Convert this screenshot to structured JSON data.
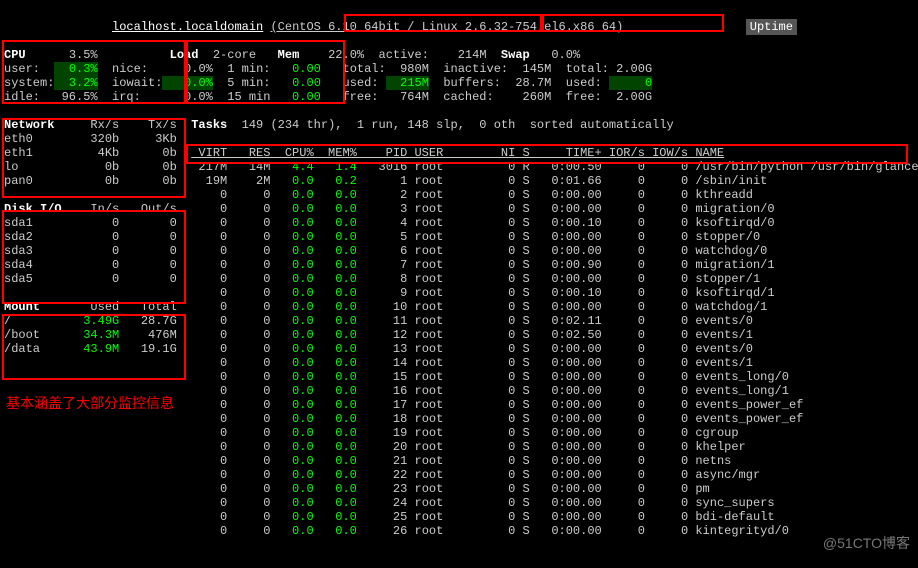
{
  "header": {
    "host": "localhost.localdomain",
    "os": "(CentOS 6.10 64bit / Linux 2.6.32-754.el6.x86_64)",
    "uptime_label": "Uptime"
  },
  "cpu": {
    "label": "CPU",
    "total": "3.5%",
    "user_label": "user:",
    "user": "0.3%",
    "nice_label": "nice:",
    "system_label": "system:",
    "system": "3.2%",
    "iowait_label": "iowait:",
    "idle_label": "idle:",
    "idle": "96.5%",
    "irq_label": "irq:"
  },
  "load": {
    "label": "Load",
    "core": "2-core",
    "c1": "0.0%",
    "m1l": "1 min:",
    "m1": "0.00",
    "c5": "0.0%",
    "m5l": "5 min:",
    "m5": "0.00",
    "c15": "0.0%",
    "m15l": "15 min",
    "m15": "0.00"
  },
  "mem": {
    "label": "Mem",
    "pct": "22.0%",
    "total_l": "total:",
    "total": "980M",
    "used_l": "used:",
    "used": "215M",
    "free_l": "free:",
    "free": "764M",
    "active_l": "active:",
    "active": "214M",
    "inactive_l": "inactive:",
    "inactive": "145M",
    "buffers_l": "buffers:",
    "buffers": "28.7M",
    "cached_l": "cached:",
    "cached": "260M"
  },
  "swap": {
    "label": "Swap",
    "pct": "0.0%",
    "total_l": "total:",
    "total": "2.00G",
    "used_l": "used:",
    "used": "0",
    "free_l": "free:",
    "free": "2.00G"
  },
  "network": {
    "label": "Network",
    "rx": "Rx/s",
    "tx": "Tx/s",
    "rows": [
      {
        "if": "eth0",
        "rx": "320b",
        "tx": "3Kb"
      },
      {
        "if": "eth1",
        "rx": "4Kb",
        "tx": "0b"
      },
      {
        "if": "lo",
        "rx": "0b",
        "tx": "0b"
      },
      {
        "if": "pan0",
        "rx": "0b",
        "tx": "0b"
      }
    ]
  },
  "disk": {
    "label": "Disk I/O",
    "in": "In/s",
    "out": "Out/s",
    "rows": [
      {
        "d": "sda1",
        "i": "0",
        "o": "0"
      },
      {
        "d": "sda2",
        "i": "0",
        "o": "0"
      },
      {
        "d": "sda3",
        "i": "0",
        "o": "0"
      },
      {
        "d": "sda4",
        "i": "0",
        "o": "0"
      },
      {
        "d": "sda5",
        "i": "0",
        "o": "0"
      }
    ]
  },
  "mount": {
    "label": "Mount",
    "used": "Used",
    "total": "Total",
    "rows": [
      {
        "m": "/",
        "u": "3.49G",
        "t": "28.7G"
      },
      {
        "m": "/boot",
        "u": "34.3M",
        "t": "476M"
      },
      {
        "m": "/data",
        "u": "43.9M",
        "t": "19.1G"
      }
    ]
  },
  "tasks": {
    "label": "Tasks",
    "summary": "149 (234 thr),  1 run, 148 slp,  0 oth  sorted automatically"
  },
  "proc_headers": {
    "virt": "VIRT",
    "res": "RES",
    "cpu": "CPU%",
    "mem": "MEM%",
    "pid": "PID",
    "user": "USER",
    "ni": "NI",
    "s": "S",
    "time": "TIME+",
    "ior": "IOR/s",
    "iow": "IOW/s",
    "name": "NAME"
  },
  "procs": [
    {
      "virt": "217M",
      "res": "14M",
      "cpu": "4.4",
      "mem": "1.4",
      "pid": "3016",
      "user": "root",
      "ni": "0",
      "s": "R",
      "time": "0:00.50",
      "ior": "0",
      "iow": "0",
      "name": "/usr/bin/python /usr/bin/glances"
    },
    {
      "virt": "19M",
      "res": "2M",
      "cpu": "0.0",
      "mem": "0.2",
      "pid": "1",
      "user": "root",
      "ni": "0",
      "s": "S",
      "time": "0:01.66",
      "ior": "0",
      "iow": "0",
      "name": "/sbin/init"
    },
    {
      "virt": "0",
      "res": "0",
      "cpu": "0.0",
      "mem": "0.0",
      "pid": "2",
      "user": "root",
      "ni": "0",
      "s": "S",
      "time": "0:00.00",
      "ior": "0",
      "iow": "0",
      "name": "kthreadd"
    },
    {
      "virt": "0",
      "res": "0",
      "cpu": "0.0",
      "mem": "0.0",
      "pid": "3",
      "user": "root",
      "ni": "0",
      "s": "S",
      "time": "0:00.00",
      "ior": "0",
      "iow": "0",
      "name": "migration/0"
    },
    {
      "virt": "0",
      "res": "0",
      "cpu": "0.0",
      "mem": "0.0",
      "pid": "4",
      "user": "root",
      "ni": "0",
      "s": "S",
      "time": "0:00.10",
      "ior": "0",
      "iow": "0",
      "name": "ksoftirqd/0"
    },
    {
      "virt": "0",
      "res": "0",
      "cpu": "0.0",
      "mem": "0.0",
      "pid": "5",
      "user": "root",
      "ni": "0",
      "s": "S",
      "time": "0:00.00",
      "ior": "0",
      "iow": "0",
      "name": "stopper/0"
    },
    {
      "virt": "0",
      "res": "0",
      "cpu": "0.0",
      "mem": "0.0",
      "pid": "6",
      "user": "root",
      "ni": "0",
      "s": "S",
      "time": "0:00.00",
      "ior": "0",
      "iow": "0",
      "name": "watchdog/0"
    },
    {
      "virt": "0",
      "res": "0",
      "cpu": "0.0",
      "mem": "0.0",
      "pid": "7",
      "user": "root",
      "ni": "0",
      "s": "S",
      "time": "0:00.90",
      "ior": "0",
      "iow": "0",
      "name": "migration/1"
    },
    {
      "virt": "0",
      "res": "0",
      "cpu": "0.0",
      "mem": "0.0",
      "pid": "8",
      "user": "root",
      "ni": "0",
      "s": "S",
      "time": "0:00.00",
      "ior": "0",
      "iow": "0",
      "name": "stopper/1"
    },
    {
      "virt": "0",
      "res": "0",
      "cpu": "0.0",
      "mem": "0.0",
      "pid": "9",
      "user": "root",
      "ni": "0",
      "s": "S",
      "time": "0:00.10",
      "ior": "0",
      "iow": "0",
      "name": "ksoftirqd/1"
    },
    {
      "virt": "0",
      "res": "0",
      "cpu": "0.0",
      "mem": "0.0",
      "pid": "10",
      "user": "root",
      "ni": "0",
      "s": "S",
      "time": "0:00.00",
      "ior": "0",
      "iow": "0",
      "name": "watchdog/1"
    },
    {
      "virt": "0",
      "res": "0",
      "cpu": "0.0",
      "mem": "0.0",
      "pid": "11",
      "user": "root",
      "ni": "0",
      "s": "S",
      "time": "0:02.11",
      "ior": "0",
      "iow": "0",
      "name": "events/0"
    },
    {
      "virt": "0",
      "res": "0",
      "cpu": "0.0",
      "mem": "0.0",
      "pid": "12",
      "user": "root",
      "ni": "0",
      "s": "S",
      "time": "0:02.50",
      "ior": "0",
      "iow": "0",
      "name": "events/1"
    },
    {
      "virt": "0",
      "res": "0",
      "cpu": "0.0",
      "mem": "0.0",
      "pid": "13",
      "user": "root",
      "ni": "0",
      "s": "S",
      "time": "0:00.00",
      "ior": "0",
      "iow": "0",
      "name": "events/0"
    },
    {
      "virt": "0",
      "res": "0",
      "cpu": "0.0",
      "mem": "0.0",
      "pid": "14",
      "user": "root",
      "ni": "0",
      "s": "S",
      "time": "0:00.00",
      "ior": "0",
      "iow": "0",
      "name": "events/1"
    },
    {
      "virt": "0",
      "res": "0",
      "cpu": "0.0",
      "mem": "0.0",
      "pid": "15",
      "user": "root",
      "ni": "0",
      "s": "S",
      "time": "0:00.00",
      "ior": "0",
      "iow": "0",
      "name": "events_long/0"
    },
    {
      "virt": "0",
      "res": "0",
      "cpu": "0.0",
      "mem": "0.0",
      "pid": "16",
      "user": "root",
      "ni": "0",
      "s": "S",
      "time": "0:00.00",
      "ior": "0",
      "iow": "0",
      "name": "events_long/1"
    },
    {
      "virt": "0",
      "res": "0",
      "cpu": "0.0",
      "mem": "0.0",
      "pid": "17",
      "user": "root",
      "ni": "0",
      "s": "S",
      "time": "0:00.00",
      "ior": "0",
      "iow": "0",
      "name": "events_power_ef"
    },
    {
      "virt": "0",
      "res": "0",
      "cpu": "0.0",
      "mem": "0.0",
      "pid": "18",
      "user": "root",
      "ni": "0",
      "s": "S",
      "time": "0:00.00",
      "ior": "0",
      "iow": "0",
      "name": "events_power_ef"
    },
    {
      "virt": "0",
      "res": "0",
      "cpu": "0.0",
      "mem": "0.0",
      "pid": "19",
      "user": "root",
      "ni": "0",
      "s": "S",
      "time": "0:00.00",
      "ior": "0",
      "iow": "0",
      "name": "cgroup"
    },
    {
      "virt": "0",
      "res": "0",
      "cpu": "0.0",
      "mem": "0.0",
      "pid": "20",
      "user": "root",
      "ni": "0",
      "s": "S",
      "time": "0:00.00",
      "ior": "0",
      "iow": "0",
      "name": "khelper"
    },
    {
      "virt": "0",
      "res": "0",
      "cpu": "0.0",
      "mem": "0.0",
      "pid": "21",
      "user": "root",
      "ni": "0",
      "s": "S",
      "time": "0:00.00",
      "ior": "0",
      "iow": "0",
      "name": "netns"
    },
    {
      "virt": "0",
      "res": "0",
      "cpu": "0.0",
      "mem": "0.0",
      "pid": "22",
      "user": "root",
      "ni": "0",
      "s": "S",
      "time": "0:00.00",
      "ior": "0",
      "iow": "0",
      "name": "async/mgr"
    },
    {
      "virt": "0",
      "res": "0",
      "cpu": "0.0",
      "mem": "0.0",
      "pid": "23",
      "user": "root",
      "ni": "0",
      "s": "S",
      "time": "0:00.00",
      "ior": "0",
      "iow": "0",
      "name": "pm"
    },
    {
      "virt": "0",
      "res": "0",
      "cpu": "0.0",
      "mem": "0.0",
      "pid": "24",
      "user": "root",
      "ni": "0",
      "s": "S",
      "time": "0:00.00",
      "ior": "0",
      "iow": "0",
      "name": "sync_supers"
    },
    {
      "virt": "0",
      "res": "0",
      "cpu": "0.0",
      "mem": "0.0",
      "pid": "25",
      "user": "root",
      "ni": "0",
      "s": "S",
      "time": "0:00.00",
      "ior": "0",
      "iow": "0",
      "name": "bdi-default"
    },
    {
      "virt": "0",
      "res": "0",
      "cpu": "0.0",
      "mem": "0.0",
      "pid": "26",
      "user": "root",
      "ni": "0",
      "s": "S",
      "time": "0:00.00",
      "ior": "0",
      "iow": "0",
      "name": "kintegrityd/0"
    }
  ],
  "annotation": "基本涵盖了大部分监控信息",
  "watermark": "@51CTO博客"
}
